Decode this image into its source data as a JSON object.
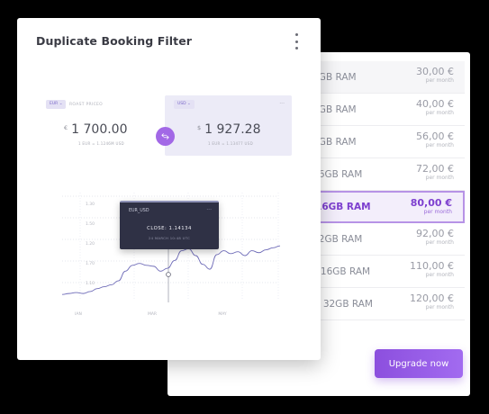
{
  "pricing": {
    "plans": [
      {
        "name": "- 4GB RAM",
        "price": "30,00 €",
        "period": "per month"
      },
      {
        "name": "- 8GB RAM",
        "price": "40,00 €",
        "period": "per month"
      },
      {
        "name": "- 8GB RAM",
        "price": "56,00 €",
        "period": "per month"
      },
      {
        "name": "- 16GB RAM",
        "price": "72,00 €",
        "period": "per month"
      },
      {
        "name": "- 16GB RAM",
        "price": "80,00 €",
        "period": "per month",
        "selected": true
      },
      {
        "name": "- 32GB RAM",
        "price": "92,00 €",
        "period": "per month"
      },
      {
        "name": "s - 16GB RAM",
        "price": "110,00 €",
        "period": "per month"
      },
      {
        "name": "'s - 32GB RAM",
        "price": "120,00 €",
        "period": "per month"
      }
    ],
    "upgrade_label": "Upgrade now"
  },
  "booking": {
    "title": "Duplicate Booking Filter",
    "menu_icon": "kebab-menu-icon",
    "from": {
      "currency": "EUR",
      "hint": "ROAST PRICEO",
      "symbol": "€",
      "amount": "1 700.00",
      "rate": "1 EUR = 1.1246M USD"
    },
    "to": {
      "currency": "USD",
      "symbol": "$",
      "amount": "1 927.28",
      "rate": "1 EUR = 1.13477 USD"
    },
    "swap_icon": "swap-currency-icon"
  },
  "chart_data": {
    "type": "line",
    "x_labels": [
      "JAN",
      "MAR",
      "MAY"
    ],
    "y_labels": [
      "1.30",
      "1.50",
      "1.20",
      "1.70",
      "1.10"
    ],
    "series": [
      {
        "values": [
          0.9,
          0.89,
          0.88,
          0.89,
          0.87,
          0.84,
          0.82,
          0.8,
          0.76,
          0.66,
          0.6,
          0.58,
          0.6,
          0.61,
          0.66,
          0.63,
          0.55,
          0.45,
          0.43,
          0.5,
          0.59,
          0.64,
          0.49,
          0.45,
          0.48,
          0.46,
          0.5,
          0.45,
          0.47,
          0.44,
          0.42,
          0.4
        ]
      }
    ],
    "tooltip": {
      "pair": "EUR_USD",
      "close": "CLOSE: 1.14134",
      "date": "24 MARCH 10:48 UTC"
    },
    "accent": "#6f6cb8"
  },
  "colors": {
    "accent": "#8c4fde",
    "selected_text": "#7d3fcf"
  }
}
